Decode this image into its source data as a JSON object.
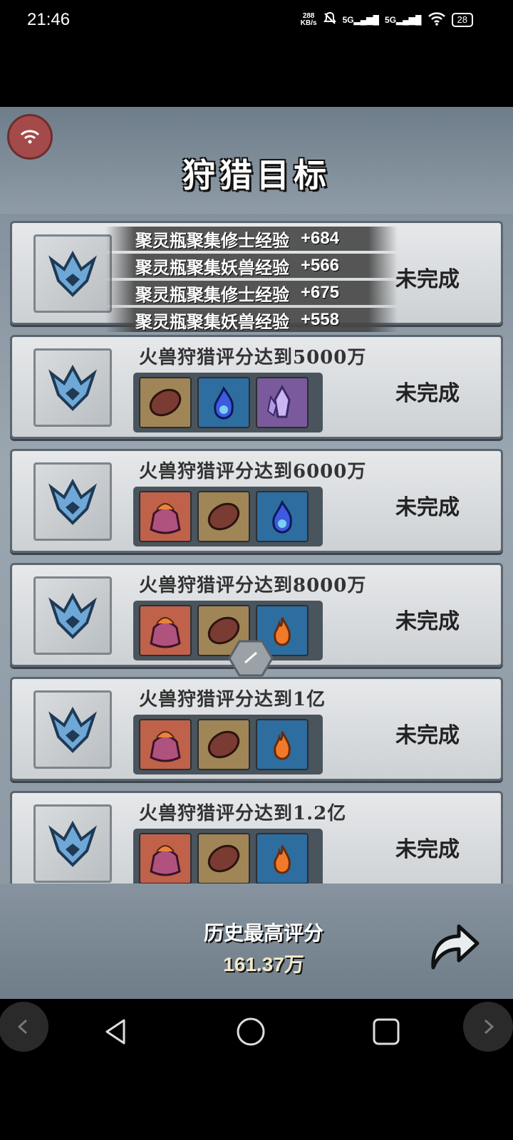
{
  "status_bar": {
    "time": "21:46",
    "net_speed_top": "288",
    "net_speed_unit": "KB/s",
    "sim1": "5G",
    "sim2": "5G",
    "battery": "28"
  },
  "header": {
    "title": "狩猎目标"
  },
  "notifications": [
    {
      "text": "聚灵瓶聚集修士经验",
      "value": "+684"
    },
    {
      "text": "聚灵瓶聚集妖兽经验",
      "value": "+566"
    },
    {
      "text": "聚灵瓶聚集修士经验",
      "value": "+675"
    },
    {
      "text": "聚灵瓶聚集妖兽经验",
      "value": "+558"
    }
  ],
  "cards": [
    {
      "goal": "",
      "status": "未完成",
      "rewards": []
    },
    {
      "goal": "火兽狩猎评分达到5000万",
      "status": "未完成",
      "rewards": [
        "scale-icon",
        "blue-flame-icon",
        "crystal-icon"
      ]
    },
    {
      "goal": "火兽狩猎评分达到6000万",
      "status": "未完成",
      "rewards": [
        "bag-icon",
        "scale-icon",
        "blue-flame-icon"
      ]
    },
    {
      "goal": "火兽狩猎评分达到8000万",
      "status": "未完成",
      "rewards": [
        "bag-icon",
        "scale-icon",
        "fire-icon"
      ]
    },
    {
      "goal": "火兽狩猎评分达到1亿",
      "status": "未完成",
      "rewards": [
        "bag-icon",
        "scale-icon",
        "fire-icon"
      ]
    },
    {
      "goal": "火兽狩猎评分达到1.2亿",
      "status": "未完成",
      "rewards": [
        "bag-icon",
        "scale-icon",
        "fire-icon"
      ]
    }
  ],
  "footer": {
    "label": "历史最高评分",
    "score": "161.37万"
  },
  "colors": {
    "accent_blue": "#2e6da0",
    "panel": "#e6e8ea",
    "wifi_button": "#a54a4a"
  }
}
